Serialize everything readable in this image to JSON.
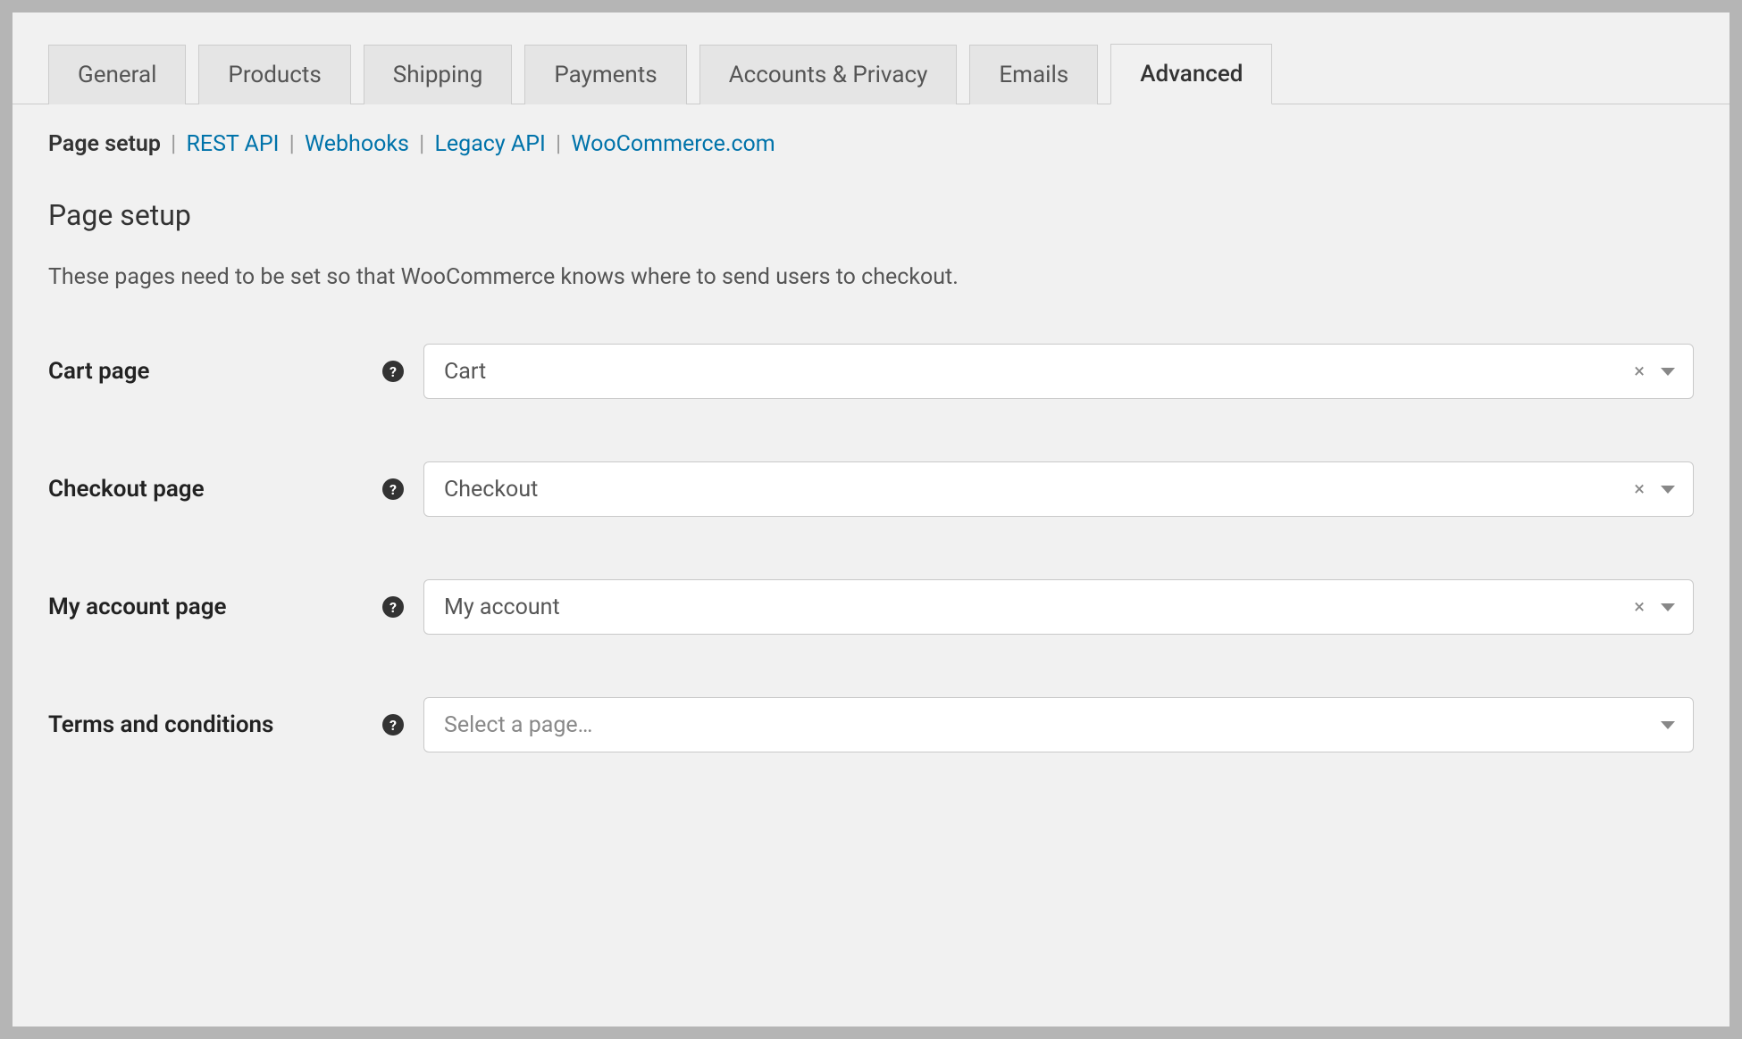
{
  "tabs": [
    {
      "label": "General",
      "active": false
    },
    {
      "label": "Products",
      "active": false
    },
    {
      "label": "Shipping",
      "active": false
    },
    {
      "label": "Payments",
      "active": false
    },
    {
      "label": "Accounts & Privacy",
      "active": false
    },
    {
      "label": "Emails",
      "active": false
    },
    {
      "label": "Advanced",
      "active": true
    }
  ],
  "subnav": {
    "current": "Page setup",
    "links": [
      "REST API",
      "Webhooks",
      "Legacy API",
      "WooCommerce.com"
    ]
  },
  "section": {
    "title": "Page setup",
    "description": "These pages need to be set so that WooCommerce knows where to send users to checkout."
  },
  "fields": {
    "cart": {
      "label": "Cart page",
      "value": "Cart",
      "clearable": true
    },
    "checkout": {
      "label": "Checkout page",
      "value": "Checkout",
      "clearable": true
    },
    "account": {
      "label": "My account page",
      "value": "My account",
      "clearable": true
    },
    "terms": {
      "label": "Terms and conditions",
      "value": "",
      "placeholder": "Select a page…",
      "clearable": false
    }
  }
}
